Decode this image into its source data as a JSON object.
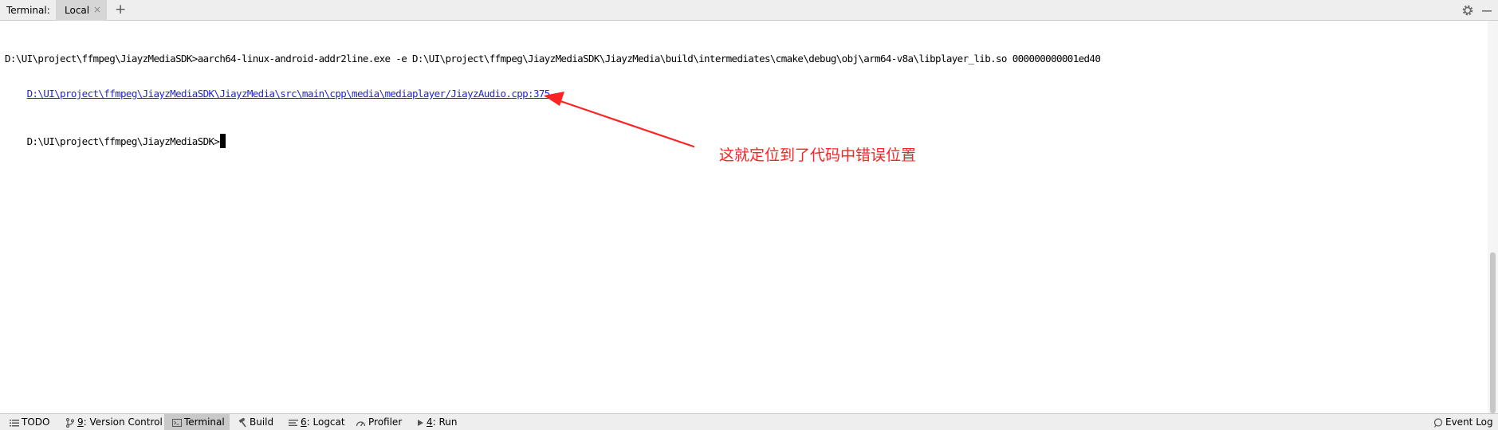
{
  "topbar": {
    "title": "Terminal:",
    "tab_label": "Local",
    "tab_close": "×",
    "add_tab": "+"
  },
  "terminal": {
    "line1": "D:\\UI\\project\\ffmpeg\\JiayzMediaSDK>aarch64-linux-android-addr2line.exe -e D:\\UI\\project\\ffmpeg\\JiayzMediaSDK\\JiayzMedia\\build\\intermediates\\cmake\\debug\\obj\\arm64-v8a\\libplayer_lib.so 000000000001ed40",
    "line2_link": "D:\\UI\\project\\ffmpeg\\JiayzMediaSDK\\JiayzMedia\\src\\main\\cpp\\media\\mediaplayer/JiayzAudio.cpp:375",
    "prompt": "D:\\UI\\project\\ffmpeg\\JiayzMediaSDK>",
    "link_color": "#2323d9"
  },
  "annotation": {
    "text": "这就定位到了代码中错误位置",
    "color": "#ff2222"
  },
  "bottombar": {
    "todo": "TODO",
    "vc_num": "9",
    "vc_label": ": Version Control",
    "terminal": "Terminal",
    "build": "Build",
    "logcat_num": "6",
    "logcat_label": ": Logcat",
    "profiler": "Profiler",
    "run_num": "4",
    "run_label": ": Run",
    "event_log": "Event Log"
  },
  "icons": [
    "gear-icon",
    "minimize-icon",
    "list-icon",
    "branch-icon",
    "terminal-icon",
    "hammer-icon",
    "logcat-icon",
    "gauge-icon",
    "play-icon",
    "bubble-icon"
  ]
}
